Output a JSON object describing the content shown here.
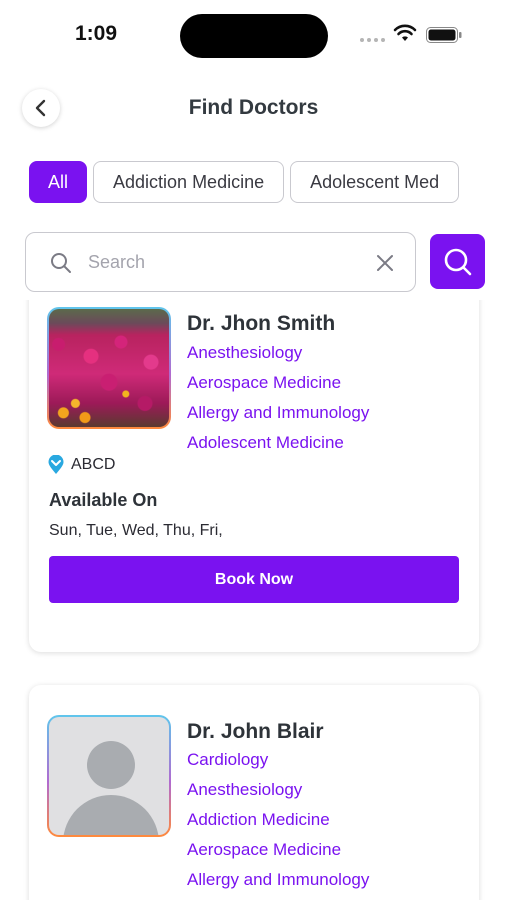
{
  "status_bar": {
    "time": "1:09"
  },
  "header": {
    "title": "Find Doctors"
  },
  "filters": {
    "chips": [
      "All",
      "Addiction Medicine",
      "Adolescent Med"
    ],
    "active_index": 0
  },
  "search": {
    "placeholder": "Search",
    "value": ""
  },
  "doctors": [
    {
      "name": "Dr. Jhon Smith",
      "specialties": [
        "Anesthesiology",
        "Aerospace Medicine",
        "Allergy and Immunology",
        "Adolescent Medicine"
      ],
      "location": "ABCD",
      "available_title": "Available On",
      "available_days": "Sun, Tue, Wed, Thu, Fri,",
      "book_label": "Book Now"
    },
    {
      "name": "Dr. John Blair",
      "specialties": [
        "Cardiology",
        "Anesthesiology",
        "Addiction Medicine",
        "Aerospace Medicine",
        "Allergy and Immunology"
      ]
    }
  ],
  "colors": {
    "accent": "#7a12f0",
    "location_pin": "#29a8e0"
  },
  "icons": [
    "back-chevron-icon",
    "search-icon",
    "clear-icon",
    "location-pin-icon",
    "avatar-placeholder-icon"
  ]
}
